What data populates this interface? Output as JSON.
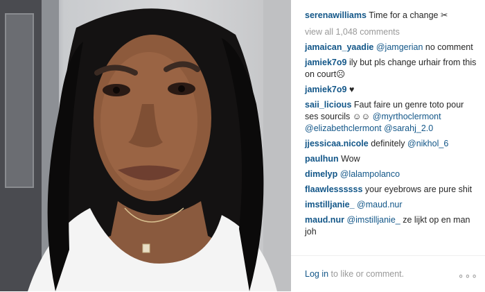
{
  "post": {
    "author": "serenawilliams",
    "caption": "Time for a change",
    "caption_icon": "scissors-icon",
    "view_all": "view all 1,048 comments"
  },
  "comments": [
    {
      "user": "jamaican_yaadie",
      "mention": "@jamgerian",
      "text": " no comment"
    },
    {
      "user": "jamiek7o9",
      "text": " ily but pls change urhair from this on court☹"
    },
    {
      "user": "jamiek7o9",
      "text": " ♥"
    },
    {
      "user": "saii_licious",
      "text": " Faut faire un genre toto pour ses sourcils ☺☺ ",
      "mention": "@myrthoclermont",
      "extra_mentions": "@elizabethclermont @sarahj_2.0"
    },
    {
      "user": "jjessicaa.nicole",
      "text": " definitely ",
      "mention": "@nikhol_6"
    },
    {
      "user": "paulhun",
      "text": " Wow"
    },
    {
      "user": "dimelyp",
      "mention": "@lalampolanco",
      "text": ""
    },
    {
      "user": "flaawlessssss",
      "text": " your eyebrows are pure shit"
    },
    {
      "user": "imstilljanie_",
      "mention": "@maud.nur",
      "text": ""
    },
    {
      "user": "maud.nur",
      "mention": "@imstilljanie_",
      "text": " ze lijkt op en man joh"
    }
  ],
  "footer": {
    "login_link": "Log in",
    "login_text": " to like or comment.",
    "more": "∘∘∘"
  },
  "colors": {
    "username": "#125688",
    "muted": "#999999",
    "text": "#262626"
  }
}
